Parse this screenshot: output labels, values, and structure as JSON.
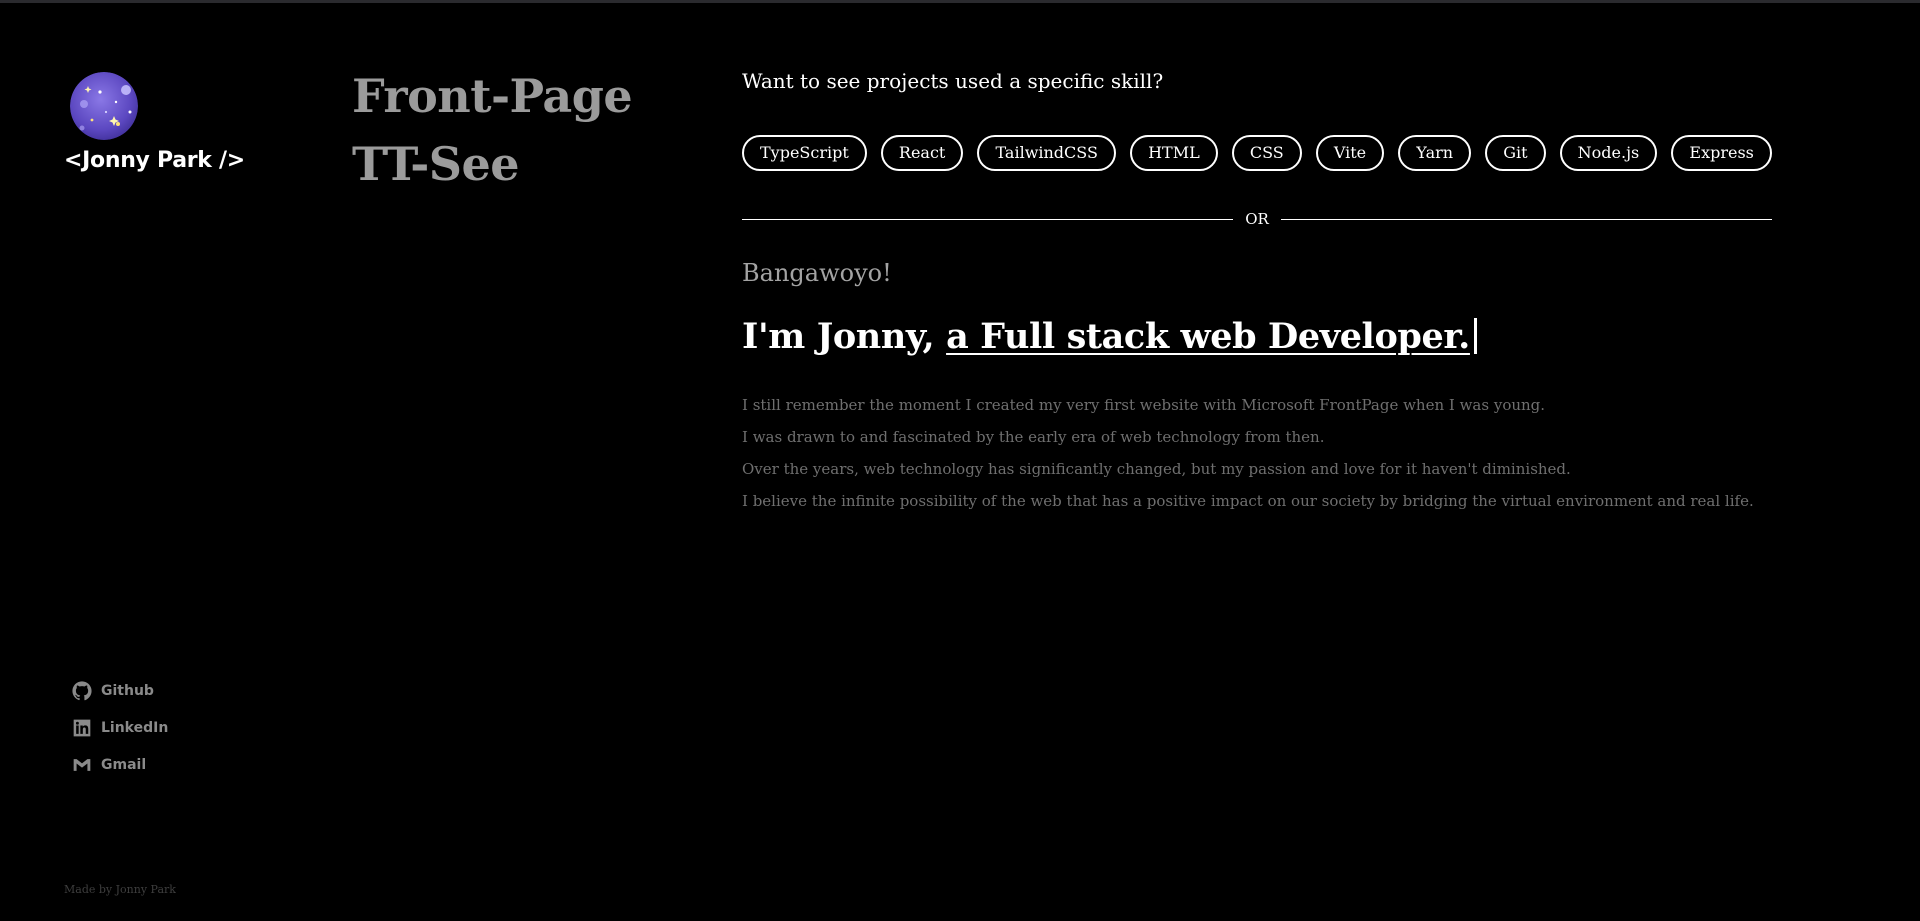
{
  "sidebar": {
    "brand": "<Jonny Park />",
    "socials": [
      {
        "label": "Github",
        "icon": "github-icon"
      },
      {
        "label": "LinkedIn",
        "icon": "linkedin-icon"
      },
      {
        "label": "Gmail",
        "icon": "gmail-icon"
      }
    ],
    "footer": "Made by Jonny Park"
  },
  "project": {
    "title_line1": "Front-Page",
    "title_line2": "TT-See"
  },
  "skills": {
    "question": "Want to see projects used a specific skill?",
    "items": [
      "TypeScript",
      "React",
      "TailwindCSS",
      "HTML",
      "CSS",
      "Vite",
      "Yarn",
      "Git",
      "Node.js",
      "Express"
    ],
    "divider": "OR"
  },
  "intro": {
    "greeting": "Bangawoyo!",
    "headline_prefix": "I'm Jonny, ",
    "headline_role": "a Full stack web Developer.",
    "bio": [
      "I still remember the moment I created my very first website with Microsoft FrontPage when I was young.",
      "I was drawn to and fascinated by the early era of web technology from then.",
      "Over the years, web technology has significantly changed, but my passion and love for it haven't diminished.",
      "I believe the infinite possibility of the web that has a positive impact on our society by bridging the virtual environment and real life."
    ]
  },
  "colors": {
    "background": "#000000",
    "text": "#ffffff",
    "muted": "#9b9b9b",
    "avatar": "#6a56c8"
  }
}
